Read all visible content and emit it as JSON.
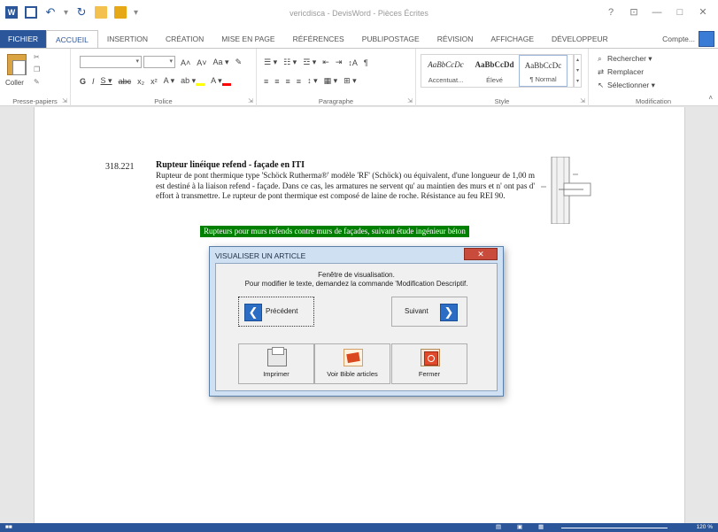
{
  "titlebar": {
    "document_title": "vericdisca - DevisWord - Pièces Écrites",
    "controls": [
      "?",
      "⊡",
      "—",
      "□",
      "✕"
    ]
  },
  "tabs": [
    "FICHIER",
    "ACCUEIL",
    "INSERTION",
    "CRÉATION",
    "MISE EN PAGE",
    "RÉFÉRENCES",
    "PUBLIPOSTAGE",
    "RÉVISION",
    "AFFICHAGE",
    "DÉVELOPPEUR"
  ],
  "active_tab": "ACCUEIL",
  "account_label": "Compte...",
  "ribbon": {
    "clipboard": {
      "paste_label": "Coller",
      "group_label": "Presse-papiers"
    },
    "font": {
      "row1": [
        "A˄",
        "A˅",
        "Aa ▾",
        "✎"
      ],
      "row2": [
        "G",
        "I",
        "S ▾",
        "abc",
        "x₂",
        "x²",
        "A ▾",
        "ab ▾",
        "A ▾"
      ],
      "group_label": "Police"
    },
    "paragraph": {
      "row1": [
        "☰ ▾",
        "☷ ▾",
        "☲ ▾",
        "⇤",
        "⇥",
        "↕A",
        "¶"
      ],
      "row2": [
        "≡",
        "≡",
        "≡",
        "≡",
        "↕ ▾",
        "▦ ▾",
        "⊞ ▾"
      ],
      "group_label": "Paragraphe"
    },
    "styles": {
      "items": [
        {
          "sample": "AaBbCcDc",
          "name": "Accentuat..."
        },
        {
          "sample": "AaBbCcDd",
          "name": "Élevé"
        },
        {
          "sample": "AaBbCcDc",
          "name": "¶ Normal"
        }
      ],
      "group_label": "Style"
    },
    "editing": {
      "find": "Rechercher ▾",
      "replace": "Remplacer",
      "select": "Sélectionner ▾",
      "group_label": "Modification"
    }
  },
  "document": {
    "article_number": "318.221",
    "article_title": "Rupteur linéique refend - façade en ITI",
    "article_body": "Rupteur de pont thermique type 'Schöck Rutherma®' modèle 'RF' (Schöck) ou équivalent, d'une longueur de 1,00 m est destiné à la liaison refend - façade. Dans ce cas, les armatures ne servent qu' au maintien des murs et n' ont pas d' effort à transmettre. Le rupteur de pont thermique est composé de laine de roche. Résistance au feu REI 90.",
    "green_banner": "Rupteurs pour murs refends contre murs de façades, suivant étude ingénieur béton"
  },
  "dialog": {
    "title": "VISUALISER UN ARTICLE",
    "close_label": "✕",
    "message_line1": "Fenêtre de visualisation.",
    "message_line2": "Pour modifier le texte, demandez la commande 'Modification Descriptif.",
    "prev_label": "Précédent",
    "next_label": "Suivant",
    "print_label": "Imprimer",
    "bible_label": "Voir Bible articles",
    "close_btn_label": "Fermer"
  },
  "status": {
    "page": "■■",
    "zoom": "120 %"
  }
}
